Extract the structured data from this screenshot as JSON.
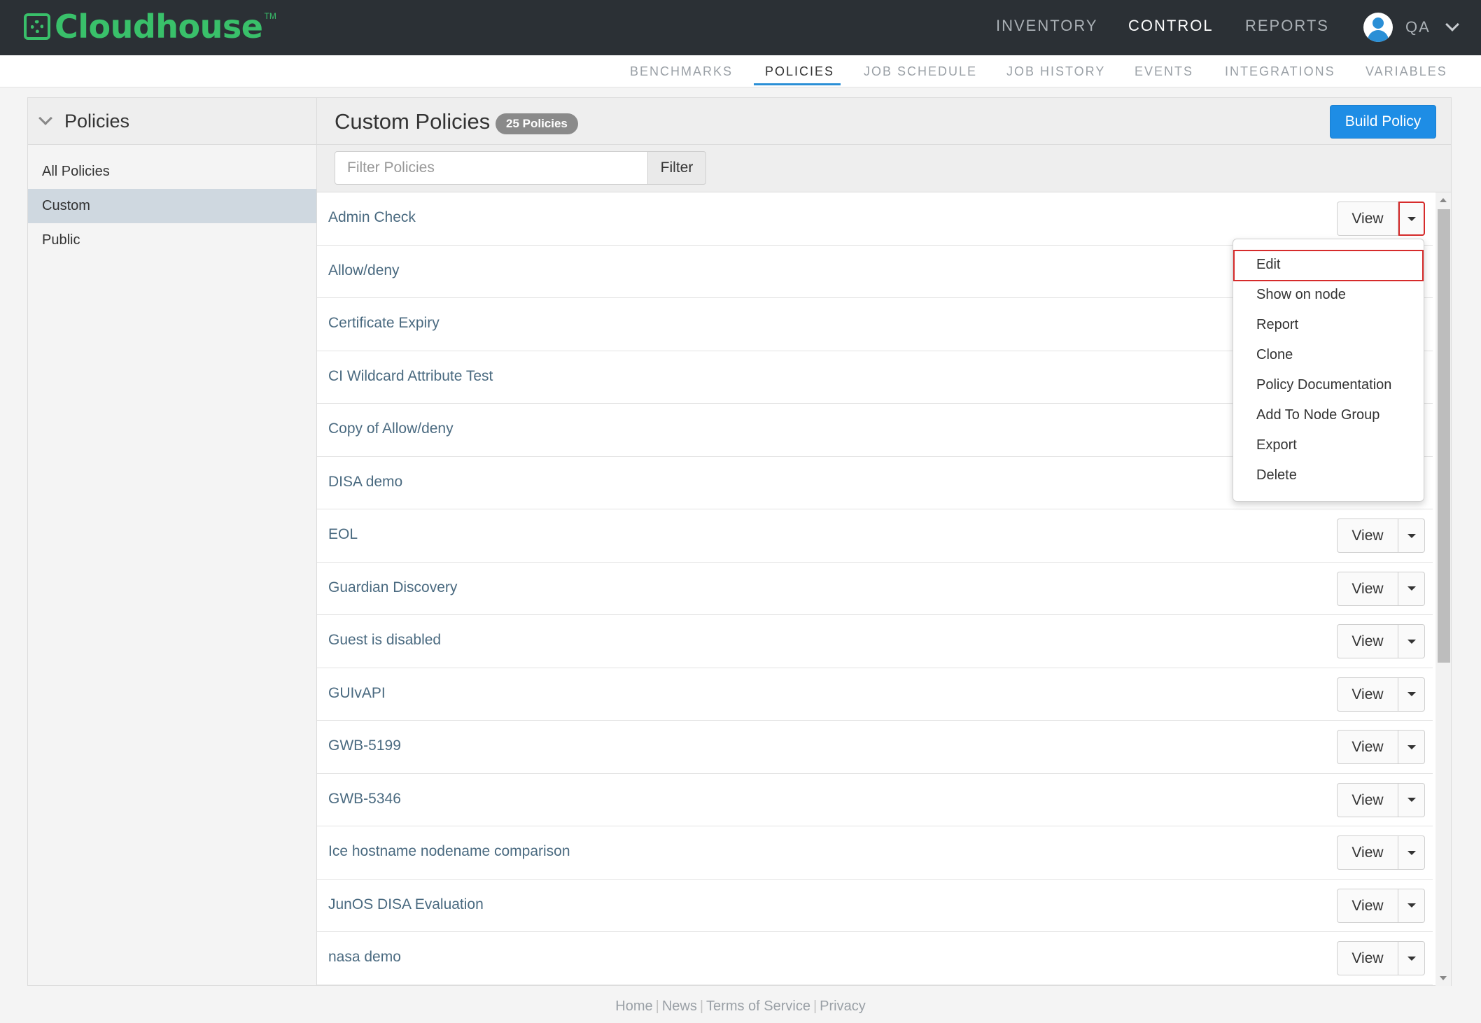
{
  "brand": {
    "name": "Cloudhouse",
    "tm": "TM"
  },
  "main_nav": [
    {
      "label": "INVENTORY",
      "active": false
    },
    {
      "label": "CONTROL",
      "active": true
    },
    {
      "label": "REPORTS",
      "active": false
    }
  ],
  "user": {
    "name": "QA"
  },
  "sub_nav": [
    {
      "label": "BENCHMARKS",
      "active": false
    },
    {
      "label": "POLICIES",
      "active": true
    },
    {
      "label": "JOB SCHEDULE",
      "active": false
    },
    {
      "label": "JOB HISTORY",
      "active": false
    },
    {
      "label": "EVENTS",
      "active": false
    },
    {
      "label": "INTEGRATIONS",
      "active": false
    },
    {
      "label": "VARIABLES",
      "active": false
    }
  ],
  "sidebar": {
    "title": "Policies",
    "items": [
      {
        "label": "All Policies",
        "active": false
      },
      {
        "label": "Custom",
        "active": true
      },
      {
        "label": "Public",
        "active": false
      }
    ]
  },
  "main": {
    "title": "Custom Policies",
    "count_badge": "25 Policies",
    "build_button": "Build Policy",
    "filter": {
      "placeholder": "Filter Policies",
      "value": "",
      "button": "Filter"
    },
    "view_label": "View",
    "policies": [
      "Admin Check",
      "Allow/deny",
      "Certificate Expiry",
      "CI Wildcard Attribute Test",
      "Copy of Allow/deny",
      "DISA demo",
      "EOL",
      "Guardian Discovery",
      "Guest is disabled",
      "GUIvAPI",
      "GWB-5199",
      "GWB-5346",
      "Ice hostname nodename comparison",
      "JunOS DISA Evaluation",
      "nasa demo"
    ]
  },
  "dropdown_menu": {
    "items": [
      "Edit",
      "Show on node",
      "Report",
      "Clone",
      "Policy Documentation",
      "Add To Node Group",
      "Export",
      "Delete"
    ],
    "highlighted": "Edit"
  },
  "footer": {
    "links": [
      "Home",
      "News",
      "Terms of Service",
      "Privacy"
    ]
  },
  "colors": {
    "topbar": "#2b3035",
    "brand_green": "#39c06a",
    "accent_blue": "#1e8de5",
    "highlight_red": "#d62b2b"
  }
}
